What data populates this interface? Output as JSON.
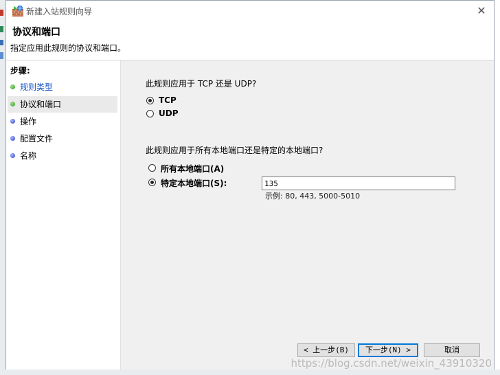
{
  "window": {
    "title": "新建入站规则向导",
    "close_glyph": "✕"
  },
  "header": {
    "title": "协议和端口",
    "description": "指定应用此规则的协议和端口。"
  },
  "steps": {
    "title": "步骤:",
    "items": [
      {
        "label": "规则类型",
        "dot": "green"
      },
      {
        "label": "协议和端口",
        "dot": "green"
      },
      {
        "label": "操作",
        "dot": "blue"
      },
      {
        "label": "配置文件",
        "dot": "blue"
      },
      {
        "label": "名称",
        "dot": "blue"
      }
    ]
  },
  "protocol": {
    "question": "此规则应用于 TCP 还是 UDP?",
    "options": [
      {
        "label": "TCP",
        "checked": true
      },
      {
        "label": "UDP",
        "checked": false
      }
    ]
  },
  "ports": {
    "question": "此规则应用于所有本地端口还是特定的本地端口?",
    "options": [
      {
        "label": "所有本地端口(A)",
        "checked": false
      },
      {
        "label": "特定本地端口(S):",
        "checked": true
      }
    ],
    "value": "135",
    "example": "示例: 80, 443, 5000-5010"
  },
  "buttons": {
    "back": "< 上一步(B)",
    "next": "下一步(N) >",
    "cancel": "取消"
  },
  "watermark": "https://blog.csdn.net/weixin_43910320"
}
